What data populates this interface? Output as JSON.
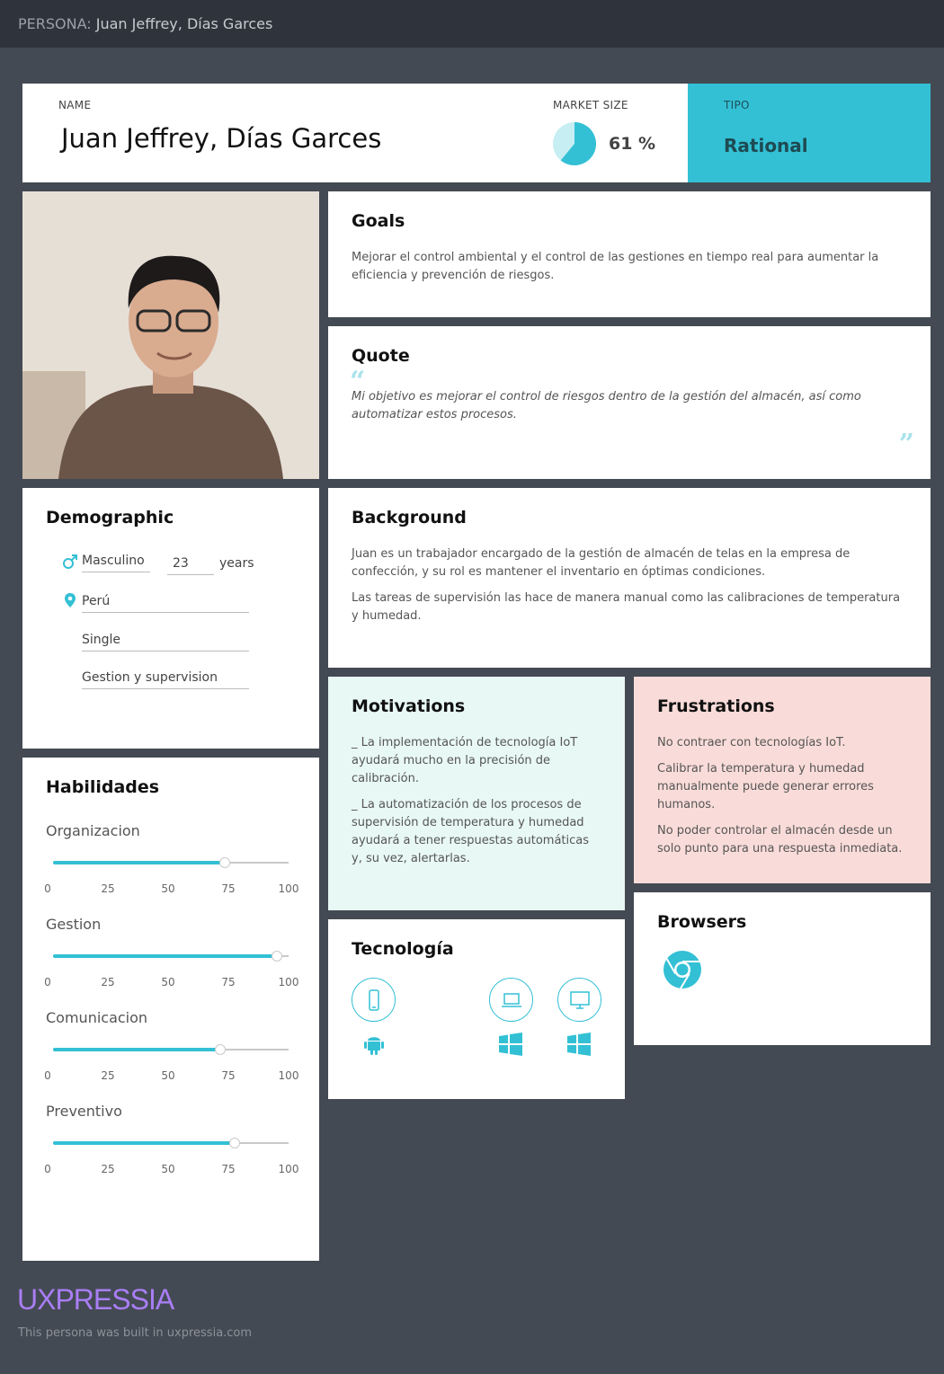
{
  "header": {
    "prefix": "PERSONA:",
    "title": "Juan Jeffrey, Días Garces"
  },
  "persona": {
    "name_label": "NAME",
    "name": "Juan Jeffrey, Días Garces",
    "market_label": "MARKET SIZE",
    "market_value": "61 %",
    "market_fraction": 0.61,
    "tipo_label": "TIPO",
    "tipo": "Rational"
  },
  "goals": {
    "title": "Goals",
    "text": "Mejorar el control ambiental y el control de las gestiones en tiempo real para aumentar la eficiencia y prevención de riesgos."
  },
  "quote": {
    "title": "Quote",
    "text": "Mi objetivo es mejorar el control de riesgos dentro de la gestión del almacén, así como automatizar estos procesos."
  },
  "demographic": {
    "title": "Demographic",
    "gender": "Masculino",
    "age": "23",
    "age_unit": "years",
    "location": "Perú",
    "status": "Single",
    "occupation": "Gestion y supervision"
  },
  "background": {
    "title": "Background",
    "p1": "Juan es un trabajador encargado de la gestión de almacén de telas en la empresa de confección, y su rol es mantener el inventario en óptimas condiciones.",
    "p2": "Las tareas de supervisión las hace de manera manual como las calibraciones de temperatura y humedad."
  },
  "motivations": {
    "title": "Motivations",
    "p1": "_ La implementación de tecnología IoT ayudará mucho en la precisión de calibración.",
    "p2": "_ La automatización de los procesos de supervisión de temperatura y humedad ayudará a tener respuestas automáticas y, su vez, alertarlas."
  },
  "frustrations": {
    "title": "Frustrations",
    "p1": "No contraer con tecnologías IoT.",
    "p2": "Calibrar la temperatura y humedad manualmente puede generar errores humanos.",
    "p3": "No poder controlar el almacén desde un solo punto para una respuesta inmediata."
  },
  "skills": {
    "title": "Habilidades",
    "ticks": [
      "0",
      "25",
      "50",
      "75",
      "100"
    ],
    "items": [
      {
        "name": "Organizacion",
        "value": 73
      },
      {
        "name": "Gestion",
        "value": 95
      },
      {
        "name": "Comunicacion",
        "value": 71
      },
      {
        "name": "Preventivo",
        "value": 77
      }
    ]
  },
  "tech": {
    "title": "Tecnología",
    "icons": [
      "smartphone-icon",
      "android-icon",
      "laptop-icon",
      "windows-icon",
      "desktop-icon",
      "windows-icon"
    ]
  },
  "browsers": {
    "title": "Browsers",
    "icons": [
      "chrome-icon"
    ]
  },
  "footer": {
    "brand": "UXPRESSIA",
    "note": "This persona was built in uxpressia.com"
  },
  "colors": {
    "accent": "#33c0d5",
    "motivation_bg": "#e8f8f5",
    "frustration_bg": "#f9dcd9",
    "brand": "#a97ef5"
  }
}
